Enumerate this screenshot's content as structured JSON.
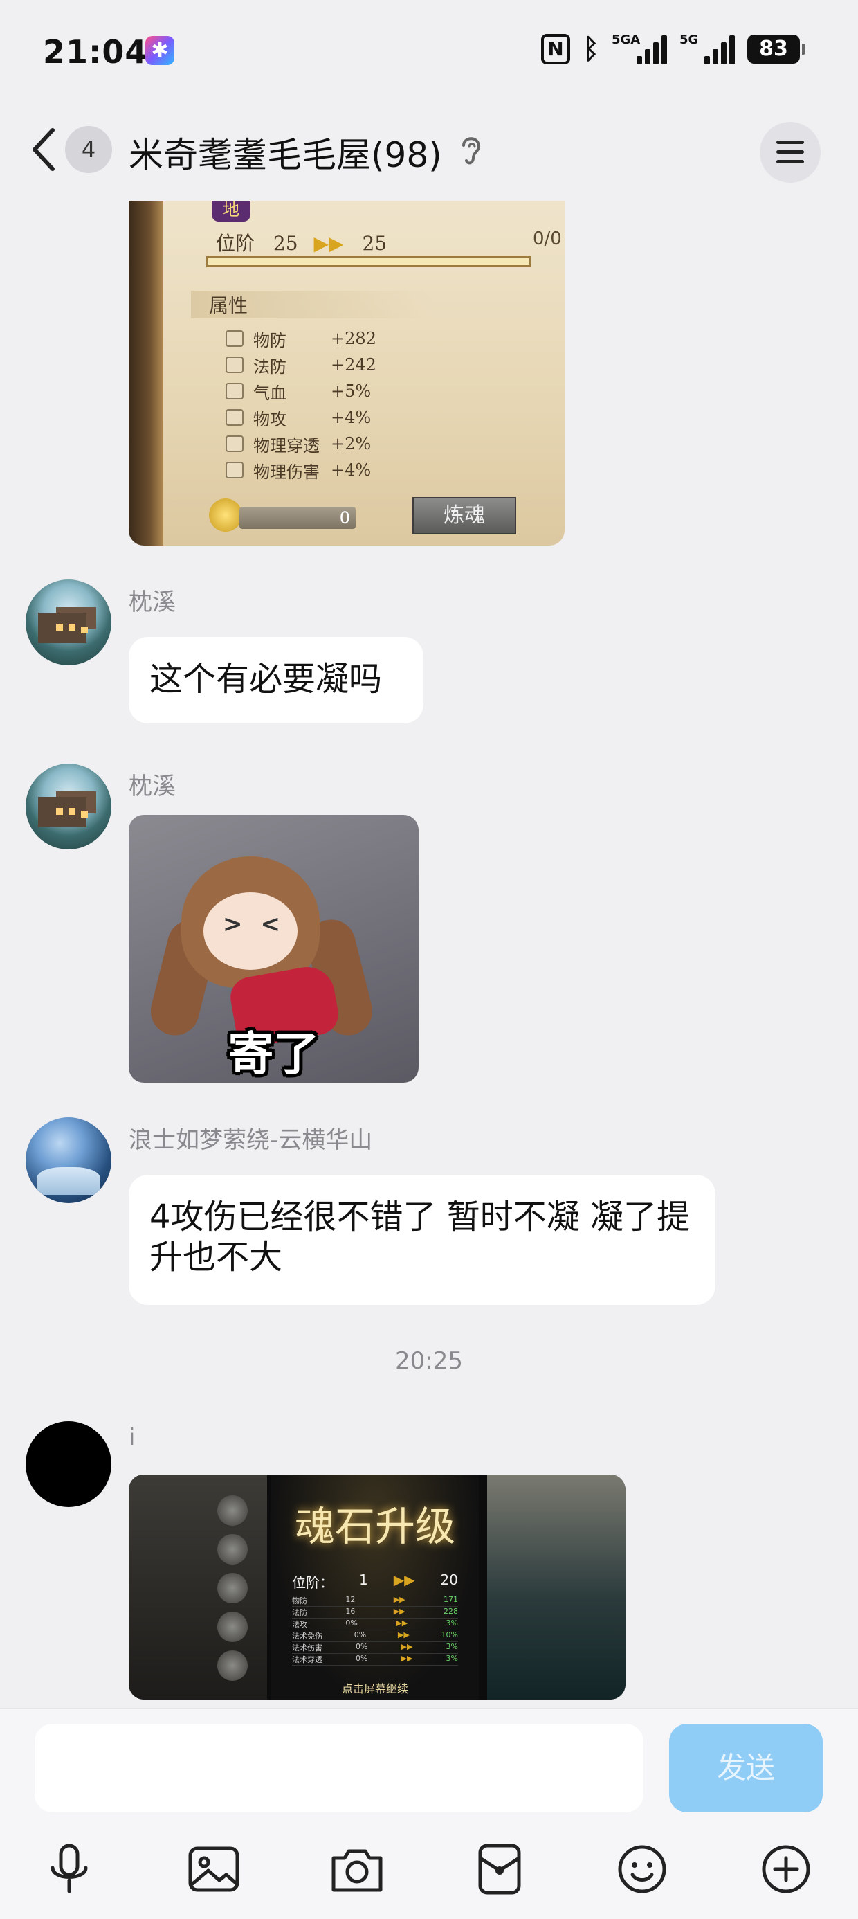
{
  "status_bar": {
    "time": "21:04",
    "app_badge_icon": "star-app-icon",
    "nfc": "N",
    "signal1_label": "5GA",
    "signal2_label": "5G",
    "battery": "83"
  },
  "header": {
    "unread_count": "4",
    "title": "米奇耄耋毛毛屋(98)",
    "ear_icon": "ear-icon",
    "menu_icon": "menu-icon"
  },
  "messages": [
    {
      "type": "image",
      "game_card": {
        "tag": "地",
        "rank_label": "位阶",
        "rank_from": "25",
        "rank_to": "25",
        "progress": "0/0",
        "section": "属性",
        "attributes": [
          {
            "name": "物防",
            "value": "+282"
          },
          {
            "name": "法防",
            "value": "+242"
          },
          {
            "name": "气血",
            "value": "+5%"
          },
          {
            "name": "物攻",
            "value": "+4%"
          },
          {
            "name": "物理穿透",
            "value": "+2%"
          },
          {
            "name": "物理伤害",
            "value": "+4%"
          }
        ],
        "coins": "0",
        "refine_button": "炼魂"
      }
    },
    {
      "sender": "枕溪",
      "text": "这个有必要凝吗"
    },
    {
      "sender": "枕溪",
      "type": "sticker",
      "caption": "寄了"
    },
    {
      "sender": "浪士如梦萦绕-云横华山",
      "text": "4攻伤已经很不错了 暂时不凝 凝了提升也不大"
    },
    {
      "type": "timestamp",
      "text": "20:25"
    },
    {
      "sender": "i",
      "type": "image",
      "game_card": {
        "title": "魂石升级",
        "rank_label": "位阶：",
        "rank_from": "1",
        "rank_to": "20",
        "rows": [
          {
            "name": "物防",
            "from": "12",
            "to": "171"
          },
          {
            "name": "法防",
            "from": "16",
            "to": "228"
          },
          {
            "name": "法攻",
            "from": "0%",
            "to": "3%"
          },
          {
            "name": "法术免伤",
            "from": "0%",
            "to": "10%"
          },
          {
            "name": "法术伤害",
            "from": "0%",
            "to": "3%"
          },
          {
            "name": "法术穿透",
            "from": "0%",
            "to": "3%"
          }
        ],
        "tap_hint": "点击屏幕继续"
      }
    }
  ],
  "input": {
    "value": "",
    "send_label": "发送"
  },
  "toolbar": [
    "microphone-icon",
    "image-icon",
    "camera-icon",
    "red-packet-icon",
    "emoji-icon",
    "plus-icon"
  ],
  "colors": {
    "background": "#f0f0f2",
    "bubble": "#ffffff",
    "send_button": "#8fcdf7"
  }
}
